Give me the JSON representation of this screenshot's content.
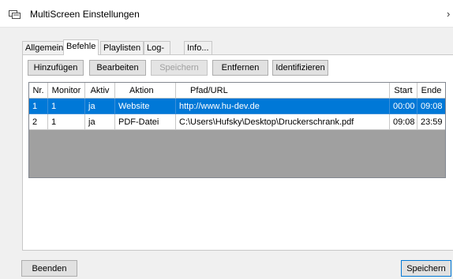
{
  "window": {
    "title": "MultiScreen Einstellungen",
    "close_glyph": "›",
    "icon": "monitor-window-icon"
  },
  "tabs": [
    {
      "label": "Allgemein",
      "active": false
    },
    {
      "label": "Befehle",
      "active": true
    },
    {
      "label": "Playlisten",
      "active": false
    },
    {
      "label": "Log-Datei",
      "active": false
    },
    {
      "label": "Info...",
      "active": false
    }
  ],
  "toolbar": {
    "add_label": "Hinzufügen",
    "edit_label": "Bearbeiten",
    "save_label": "Speichern",
    "remove_label": "Entfernen",
    "identify_label": "Identifizieren"
  },
  "table": {
    "columns": [
      "Nr.",
      "Monitor",
      "Aktiv",
      "Aktion",
      "Pfad/URL",
      "Start",
      "Ende"
    ],
    "rows": [
      {
        "cells": [
          "1",
          "1",
          "ja",
          "Website",
          "http://www.hu-dev.de",
          "00:00",
          "09:08"
        ],
        "selected": true
      },
      {
        "cells": [
          "2",
          "1",
          "ja",
          "PDF-Datei",
          "C:\\Users\\Hufsky\\Desktop\\Druckerschrank.pdf",
          "09:08",
          "23:59"
        ],
        "selected": false
      }
    ]
  },
  "footer": {
    "exit_label": "Beenden",
    "save_label": "Speichern"
  },
  "colors": {
    "selection": "#0078d7",
    "grid_background": "#a0a0a0",
    "dialog_background": "#f0f0f0"
  }
}
